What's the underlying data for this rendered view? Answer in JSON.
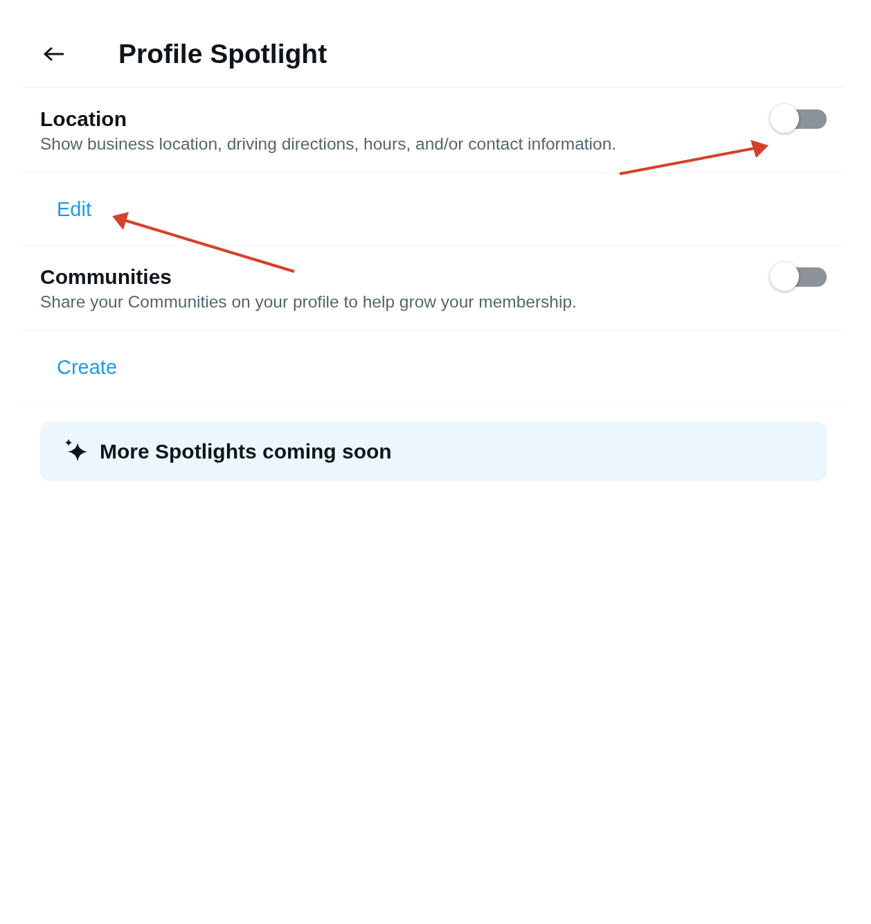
{
  "header": {
    "title": "Profile Spotlight"
  },
  "sections": [
    {
      "title": "Location",
      "description": "Show business location, driving directions, hours, and/or contact information.",
      "on": false,
      "action": "Edit"
    },
    {
      "title": "Communities",
      "description": "Share your Communities on your profile to help grow your membership.",
      "on": false,
      "action": "Create"
    }
  ],
  "banner": {
    "text": "More Spotlights coming soon"
  }
}
